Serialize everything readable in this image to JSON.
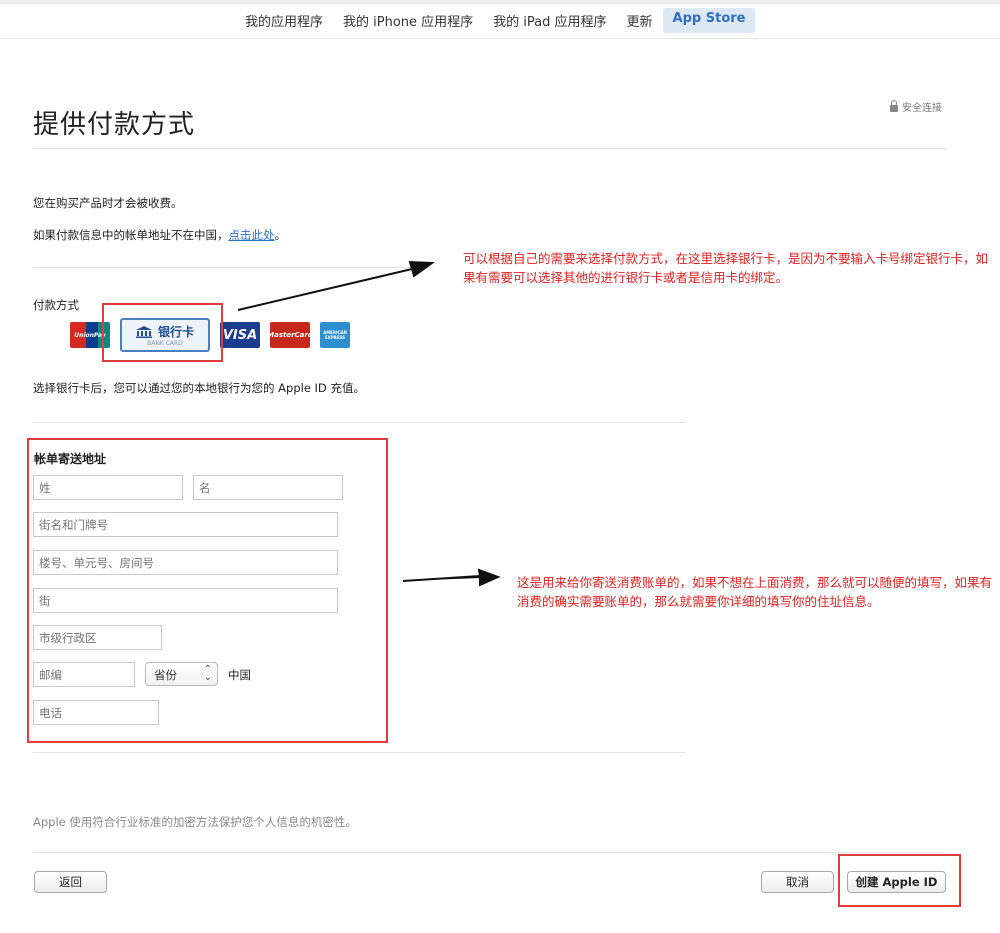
{
  "nav": {
    "items": [
      "我的应用程序",
      "我的 iPhone 应用程序",
      "我的 iPad 应用程序",
      "更新",
      "App Store"
    ],
    "active_index": 4
  },
  "secure_label": "安全连接",
  "page_title": "提供付款方式",
  "intro": {
    "charge_note": "您在购买产品时才会被收费。",
    "billing_prefix": "如果付款信息中的帐单地址不在中国，",
    "billing_link": "点击此处",
    "billing_suffix": "。"
  },
  "payment": {
    "label": "付款方式",
    "cards": {
      "unionpay": "UnionPay",
      "bankcard_title": "银行卡",
      "bankcard_sub": "BANK CARD",
      "visa": "VISA",
      "mastercard": "MasterCard",
      "amex": "AMERICAN EXPRESS"
    },
    "note": "选择银行卡后，您可以通过您的本地银行为您的 Apple ID 充值。"
  },
  "annotations": {
    "payment": "可以根据自己的需要来选择付款方式，在这里选择银行卡，是因为不要输入卡号绑定银行卡，如果有需要可以选择其他的进行银行卡或者是信用卡的绑定。",
    "address": "这是用来给你寄送消费账单的，如果不想在上面消费，那么就可以随便的填写，如果有消费的确实需要账单的，那么就需要你详细的填写你的住址信息。"
  },
  "billing": {
    "title": "帐单寄送地址",
    "last_name_placeholder": "姓",
    "first_name_placeholder": "名",
    "street_placeholder": "街名和门牌号",
    "building_placeholder": "楼号、单元号、房间号",
    "district_placeholder": "街",
    "city_placeholder": "市级行政区",
    "postal_placeholder": "邮编",
    "province_value": "省份",
    "country": "中国",
    "phone_placeholder": "电话"
  },
  "privacy_note": "Apple 使用符合行业标准的加密方法保护您个人信息的机密性。",
  "buttons": {
    "back": "返回",
    "cancel": "取消",
    "create": "创建 Apple ID"
  },
  "colors": {
    "accent": "#2f6fbf",
    "annotation": "#e02222",
    "link": "#2a6fc9"
  }
}
